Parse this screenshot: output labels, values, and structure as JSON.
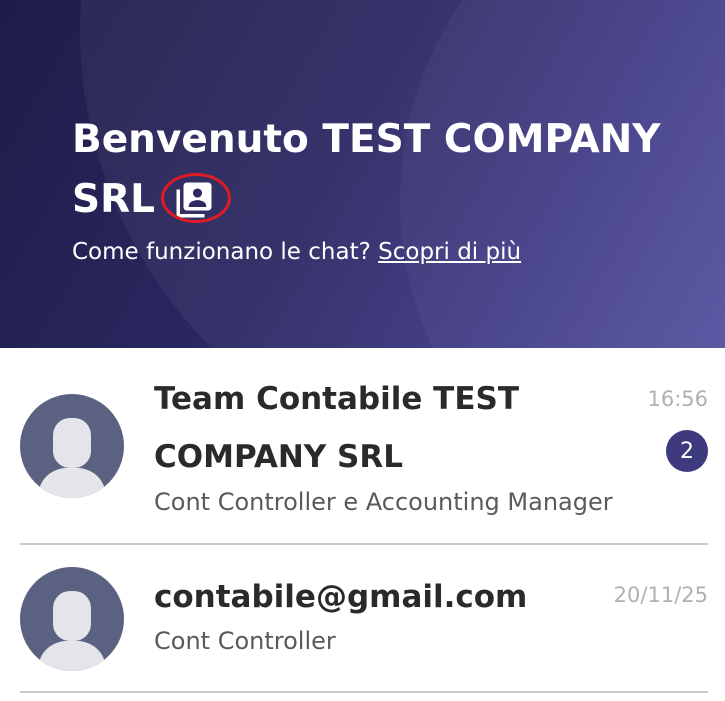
{
  "header": {
    "title_line1": "Benvenuto TEST COMPANY",
    "title_line2": "SRL",
    "help_text": "Come funzionano le chat?",
    "help_link": "Scopri di più",
    "profile_icon": "contacts-book-icon",
    "highlight_color": "#e01b24"
  },
  "chats": [
    {
      "name": "Team Contabile TEST COMPANY SRL",
      "subtitle": "Cont Controller e Accounting Manager",
      "time": "16:56",
      "unread": "2",
      "avatar_icon": "user-silhouette-icon"
    },
    {
      "name": "contabile@gmail.com",
      "subtitle": "Cont Controller",
      "time": "20/11/25",
      "avatar_icon": "user-silhouette-icon"
    }
  ],
  "colors": {
    "header_dark": "#1e1c48",
    "header_light": "#4f4a9c",
    "badge": "#3d3a7e",
    "avatar": "#5b6180"
  }
}
